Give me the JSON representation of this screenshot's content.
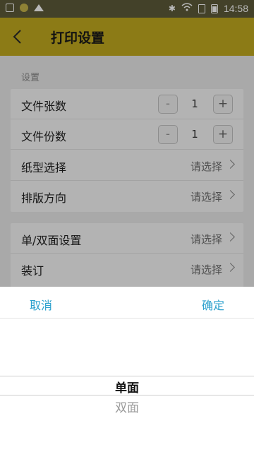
{
  "status_bar": {
    "time": "14:58"
  },
  "app_bar": {
    "title": "打印设置"
  },
  "section": {
    "label": "设置"
  },
  "card1": {
    "rows": [
      {
        "label": "文件张数",
        "minus": "-",
        "value": "1",
        "plus": "+"
      },
      {
        "label": "文件份数",
        "minus": "-",
        "value": "1",
        "plus": "+"
      },
      {
        "label": "纸型选择",
        "value": "请选择"
      },
      {
        "label": "排版方向",
        "value": "请选择"
      }
    ]
  },
  "card2": {
    "rows": [
      {
        "label": "单/双面设置",
        "value": "请选择"
      },
      {
        "label": "装订",
        "value": "请选择"
      }
    ]
  },
  "picker": {
    "cancel": "取消",
    "confirm": "确定",
    "selected": "单面",
    "options": [
      "双面"
    ]
  },
  "colors": {
    "accent": "#c2ab1f",
    "link": "#2aa0cd"
  }
}
